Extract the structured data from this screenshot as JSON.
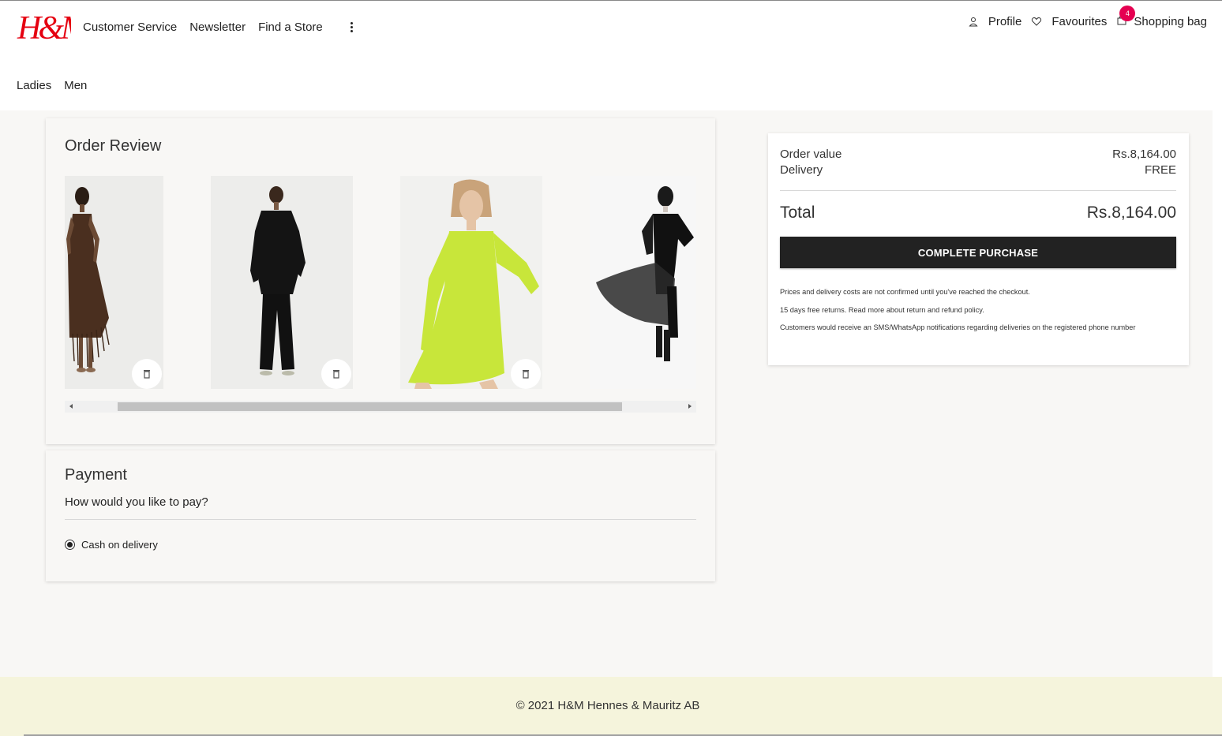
{
  "brand": {
    "logo_text": "H&M",
    "logo_color": "#e50010"
  },
  "header": {
    "nav": [
      "Customer Service",
      "Newsletter",
      "Find a Store"
    ],
    "profile_label": "Profile",
    "favourites_label": "Favourites",
    "bag_label": "Shopping bag",
    "bag_count": "4",
    "departments": [
      "Ladies",
      "Men"
    ]
  },
  "order_review": {
    "title": "Order Review",
    "products": [
      {
        "icon": "product-brown-fringe-dress"
      },
      {
        "icon": "product-black-suit"
      },
      {
        "icon": "product-lime-mesh-dress"
      },
      {
        "icon": "product-black-chiffon-dress"
      }
    ]
  },
  "payment": {
    "title": "Payment",
    "question": "How would you like to pay?",
    "options": [
      {
        "label": "Cash on delivery",
        "selected": true
      }
    ]
  },
  "summary": {
    "order_value_label": "Order value",
    "order_value": "Rs.8,164.00",
    "delivery_label": "Delivery",
    "delivery_value": "FREE",
    "total_label": "Total",
    "total_value": "Rs.8,164.00",
    "cta": "COMPLETE PURCHASE",
    "notes": [
      "Prices and delivery costs are not confirmed until you've reached the checkout.",
      "15 days free returns. Read more about return and refund policy.",
      "Customers would receive an SMS/WhatsApp notifications regarding deliveries on the registered phone number"
    ]
  },
  "footer": {
    "copyright": "© 2021 H&M Hennes & Mauritz AB"
  },
  "colors": {
    "accent": "#e50051",
    "button": "#222222",
    "page_bg": "#f8f7f5",
    "footer_bg": "#f5f4dc"
  }
}
